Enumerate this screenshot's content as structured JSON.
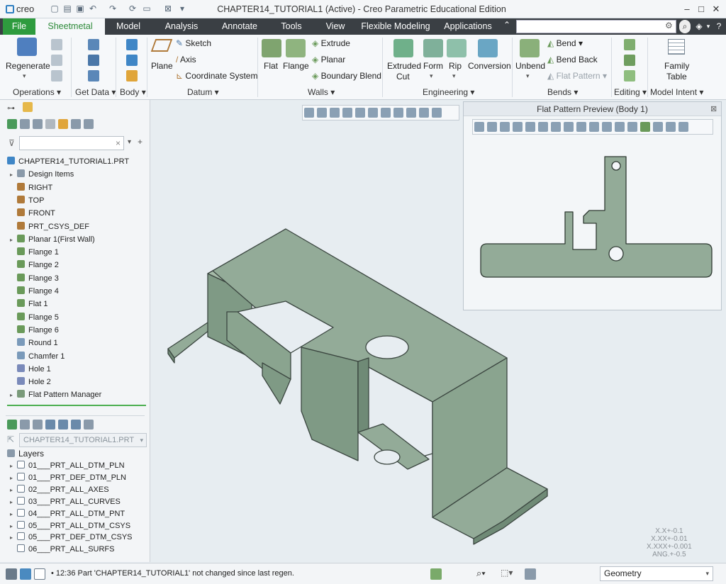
{
  "window": {
    "logo": "creo",
    "title": "CHAPTER14_TUTORIAL1 (Active) - Creo Parametric Educational Edition"
  },
  "menu": {
    "tabs": [
      "File",
      "Sheetmetal",
      "Model",
      "Analysis",
      "Annotate",
      "Tools",
      "View",
      "Flexible Modeling",
      "Applications"
    ]
  },
  "ribbon": {
    "regenerate": "Regenerate",
    "plane": "Plane",
    "sketch": "Sketch",
    "axis": "Axis",
    "coord": "Coordinate System",
    "flat": "Flat",
    "flange": "Flange",
    "extrude": "Extrude",
    "planar": "Planar",
    "boundary_blend": "Boundary Blend",
    "extruded_cut_1": "Extruded",
    "extruded_cut_2": "Cut",
    "form": "Form",
    "rip": "Rip",
    "conversion": "Conversion",
    "unbend": "Unbend",
    "bend": "Bend",
    "bend_back": "Bend Back",
    "flat_pattern": "Flat Pattern",
    "family_table_1": "Family",
    "family_table_2": "Table",
    "groups": {
      "operations": "Operations",
      "get_data": "Get Data",
      "body": "Body",
      "datum": "Datum",
      "walls": "Walls",
      "engineering": "Engineering",
      "bends": "Bends",
      "editing": "Editing",
      "model_intent": "Model Intent"
    }
  },
  "model_tree": {
    "items": [
      "CHAPTER14_TUTORIAL1.PRT",
      "Design Items",
      "RIGHT",
      "TOP",
      "FRONT",
      "PRT_CSYS_DEF",
      "Planar 1(First Wall)",
      "Flange 1",
      "Flange 2",
      "Flange 3",
      "Flange 4",
      "Flat 1",
      "Flange 5",
      "Flange 6",
      "Round 1",
      "Chamfer 1",
      "Hole 1",
      "Hole 2",
      "Flat Pattern Manager"
    ]
  },
  "layer_tree": {
    "model_select": "CHAPTER14_TUTORIAL1.PRT",
    "header": "Layers",
    "items": [
      "01___PRT_ALL_DTM_PLN",
      "01___PRT_DEF_DTM_PLN",
      "02___PRT_ALL_AXES",
      "03___PRT_ALL_CURVES",
      "04___PRT_ALL_DTM_PNT",
      "05___PRT_ALL_DTM_CSYS",
      "05___PRT_DEF_DTM_CSYS",
      "06___PRT_ALL_SURFS"
    ]
  },
  "flat_pattern": {
    "title": "Flat Pattern Preview (Body 1)"
  },
  "tolerance": [
    "X.X+-0.1",
    "X.XX+-0.01",
    "X.XXX+-0.001",
    "ANG.+-0.5"
  ],
  "status": {
    "message": "12:36 Part 'CHAPTER14_TUTORIAL1' not changed since last regen.",
    "filter": "Geometry"
  },
  "colors": {
    "part": "#93ab98",
    "part_dark": "#6f8a76",
    "part_inner": "#7f9a85",
    "accent_green": "#2e9b3e"
  }
}
